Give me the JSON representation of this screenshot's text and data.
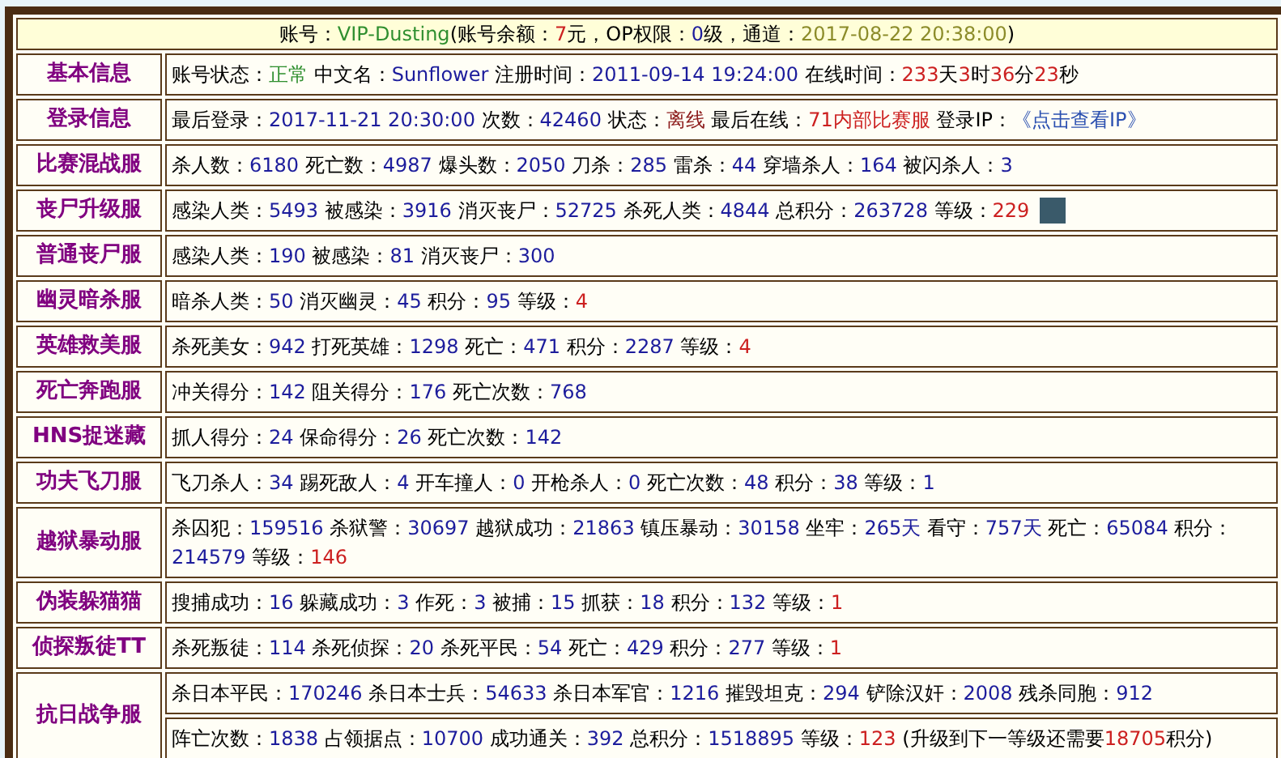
{
  "header": [
    [
      {
        "text": "账号：",
        "kind": "text"
      },
      {
        "text": "VIP-Dusting",
        "kind": "green"
      },
      {
        "text": "(账号余额：",
        "kind": "text"
      },
      {
        "text": "7",
        "kind": "red"
      },
      {
        "text": "元，OP权限：",
        "kind": "text"
      },
      {
        "text": "0",
        "kind": "num"
      },
      {
        "text": "级，通道：",
        "kind": "text"
      },
      {
        "text": "2017-08-22 20:38:00",
        "kind": "date"
      },
      {
        "text": ")",
        "kind": "text"
      }
    ]
  ],
  "rows": [
    {
      "label": "基本信息",
      "lines": [
        [
          [
            {
              "text": "账号状态：",
              "kind": "text"
            },
            {
              "text": "正常",
              "kind": "green"
            }
          ],
          [
            {
              "text": "中文名：",
              "kind": "text"
            },
            {
              "text": "Sunflower",
              "kind": "num"
            }
          ],
          [
            {
              "text": "注册时间：",
              "kind": "text"
            },
            {
              "text": "2011-09-14 19:24:00",
              "kind": "num"
            }
          ],
          [
            {
              "text": "在线时间：",
              "kind": "text"
            },
            {
              "text": "233",
              "kind": "red"
            },
            {
              "text": "天",
              "kind": "text"
            },
            {
              "text": "3",
              "kind": "red"
            },
            {
              "text": "时",
              "kind": "text"
            },
            {
              "text": "36",
              "kind": "red"
            },
            {
              "text": "分",
              "kind": "text"
            },
            {
              "text": "23",
              "kind": "red"
            },
            {
              "text": "秒",
              "kind": "text"
            }
          ]
        ]
      ]
    },
    {
      "label": "登录信息",
      "lines": [
        [
          [
            {
              "text": "最后登录：",
              "kind": "text"
            },
            {
              "text": "2017-11-21 20:30:00",
              "kind": "num"
            }
          ],
          [
            {
              "text": "次数：",
              "kind": "text"
            },
            {
              "text": "42460",
              "kind": "num"
            }
          ],
          [
            {
              "text": "状态：",
              "kind": "text"
            },
            {
              "text": "离线",
              "kind": "darkred"
            }
          ],
          [
            {
              "text": "最后在线：",
              "kind": "text"
            },
            {
              "text": "71内部比赛服",
              "kind": "red"
            }
          ],
          [
            {
              "text": "登录IP：",
              "kind": "text"
            },
            {
              "text": "《点击查看IP》",
              "kind": "link"
            }
          ]
        ]
      ]
    },
    {
      "label": "比赛混战服",
      "lines": [
        [
          [
            {
              "text": "杀人数：",
              "kind": "text"
            },
            {
              "text": "6180",
              "kind": "num"
            }
          ],
          [
            {
              "text": "死亡数：",
              "kind": "text"
            },
            {
              "text": "4987",
              "kind": "num"
            }
          ],
          [
            {
              "text": "爆头数：",
              "kind": "text"
            },
            {
              "text": "2050",
              "kind": "num"
            }
          ],
          [
            {
              "text": "刀杀：",
              "kind": "text"
            },
            {
              "text": "285",
              "kind": "num"
            }
          ],
          [
            {
              "text": "雷杀：",
              "kind": "text"
            },
            {
              "text": "44",
              "kind": "num"
            }
          ],
          [
            {
              "text": "穿墙杀人：",
              "kind": "text"
            },
            {
              "text": "164",
              "kind": "num"
            }
          ],
          [
            {
              "text": "被闪杀人：",
              "kind": "text"
            },
            {
              "text": "3",
              "kind": "num"
            }
          ]
        ]
      ]
    },
    {
      "label": "丧尸升级服",
      "lines": [
        [
          [
            {
              "text": "感染人类：",
              "kind": "text"
            },
            {
              "text": "5493",
              "kind": "num"
            }
          ],
          [
            {
              "text": "被感染：",
              "kind": "text"
            },
            {
              "text": "3916",
              "kind": "num"
            }
          ],
          [
            {
              "text": "消灭丧尸：",
              "kind": "text"
            },
            {
              "text": "52725",
              "kind": "num"
            }
          ],
          [
            {
              "text": "杀死人类：",
              "kind": "text"
            },
            {
              "text": "4844",
              "kind": "num"
            }
          ],
          [
            {
              "text": "总积分：",
              "kind": "text"
            },
            {
              "text": "263728",
              "kind": "num"
            }
          ],
          [
            {
              "text": "等级：",
              "kind": "text"
            },
            {
              "text": "229",
              "kind": "red"
            }
          ]
        ]
      ],
      "photo": true
    },
    {
      "label": "普通丧尸服",
      "lines": [
        [
          [
            {
              "text": "感染人类：",
              "kind": "text"
            },
            {
              "text": "190",
              "kind": "num"
            }
          ],
          [
            {
              "text": "被感染：",
              "kind": "text"
            },
            {
              "text": "81",
              "kind": "num"
            }
          ],
          [
            {
              "text": "消灭丧尸：",
              "kind": "text"
            },
            {
              "text": "300",
              "kind": "num"
            }
          ]
        ]
      ]
    },
    {
      "label": "幽灵暗杀服",
      "lines": [
        [
          [
            {
              "text": "暗杀人类：",
              "kind": "text"
            },
            {
              "text": "50",
              "kind": "num"
            }
          ],
          [
            {
              "text": "消灭幽灵：",
              "kind": "text"
            },
            {
              "text": "45",
              "kind": "num"
            }
          ],
          [
            {
              "text": "积分：",
              "kind": "text"
            },
            {
              "text": "95",
              "kind": "num"
            }
          ],
          [
            {
              "text": "等级：",
              "kind": "text"
            },
            {
              "text": "4",
              "kind": "red"
            }
          ]
        ]
      ]
    },
    {
      "label": "英雄救美服",
      "lines": [
        [
          [
            {
              "text": "杀死美女：",
              "kind": "text"
            },
            {
              "text": "942",
              "kind": "num"
            }
          ],
          [
            {
              "text": "打死英雄：",
              "kind": "text"
            },
            {
              "text": "1298",
              "kind": "num"
            }
          ],
          [
            {
              "text": "死亡：",
              "kind": "text"
            },
            {
              "text": "471",
              "kind": "num"
            }
          ],
          [
            {
              "text": "积分：",
              "kind": "text"
            },
            {
              "text": "2287",
              "kind": "num"
            }
          ],
          [
            {
              "text": "等级：",
              "kind": "text"
            },
            {
              "text": "4",
              "kind": "red"
            }
          ]
        ]
      ]
    },
    {
      "label": "死亡奔跑服",
      "lines": [
        [
          [
            {
              "text": "冲关得分：",
              "kind": "text"
            },
            {
              "text": "142",
              "kind": "num"
            }
          ],
          [
            {
              "text": "阻关得分：",
              "kind": "text"
            },
            {
              "text": "176",
              "kind": "num"
            }
          ],
          [
            {
              "text": "死亡次数：",
              "kind": "text"
            },
            {
              "text": "768",
              "kind": "num"
            }
          ]
        ]
      ]
    },
    {
      "label": "HNS捉迷藏",
      "lines": [
        [
          [
            {
              "text": "抓人得分：",
              "kind": "text"
            },
            {
              "text": "24",
              "kind": "num"
            }
          ],
          [
            {
              "text": "保命得分：",
              "kind": "text"
            },
            {
              "text": "26",
              "kind": "num"
            }
          ],
          [
            {
              "text": "死亡次数：",
              "kind": "text"
            },
            {
              "text": "142",
              "kind": "num"
            }
          ]
        ]
      ]
    },
    {
      "label": "功夫飞刀服",
      "lines": [
        [
          [
            {
              "text": "飞刀杀人：",
              "kind": "text"
            },
            {
              "text": "34",
              "kind": "num"
            }
          ],
          [
            {
              "text": "踢死敌人：",
              "kind": "text"
            },
            {
              "text": "4",
              "kind": "num"
            }
          ],
          [
            {
              "text": "开车撞人：",
              "kind": "text"
            },
            {
              "text": "0",
              "kind": "num"
            }
          ],
          [
            {
              "text": "开枪杀人：",
              "kind": "text"
            },
            {
              "text": "0",
              "kind": "num"
            }
          ],
          [
            {
              "text": "死亡次数：",
              "kind": "text"
            },
            {
              "text": "48",
              "kind": "num"
            }
          ],
          [
            {
              "text": "积分：",
              "kind": "text"
            },
            {
              "text": "38",
              "kind": "num"
            }
          ],
          [
            {
              "text": "等级：",
              "kind": "text"
            },
            {
              "text": "1",
              "kind": "num"
            }
          ]
        ]
      ]
    },
    {
      "label": "越狱暴动服",
      "lines": [
        [
          [
            {
              "text": "杀囚犯：",
              "kind": "text"
            },
            {
              "text": "159516",
              "kind": "num"
            }
          ],
          [
            {
              "text": "杀狱警：",
              "kind": "text"
            },
            {
              "text": "30697",
              "kind": "num"
            }
          ],
          [
            {
              "text": "越狱成功：",
              "kind": "text"
            },
            {
              "text": "21863",
              "kind": "num"
            }
          ],
          [
            {
              "text": "镇压暴动：",
              "kind": "text"
            },
            {
              "text": "30158",
              "kind": "num"
            }
          ],
          [
            {
              "text": "坐牢：",
              "kind": "text"
            },
            {
              "text": "265天",
              "kind": "num"
            }
          ],
          [
            {
              "text": "看守：",
              "kind": "text"
            },
            {
              "text": "757天",
              "kind": "num"
            }
          ],
          [
            {
              "text": "死亡：",
              "kind": "text"
            },
            {
              "text": "65084",
              "kind": "num"
            }
          ],
          [
            {
              "text": "积分：",
              "kind": "text"
            },
            {
              "text": "214579",
              "kind": "num"
            }
          ],
          [
            {
              "text": "等级：",
              "kind": "text"
            },
            {
              "text": "146",
              "kind": "red"
            }
          ]
        ]
      ]
    },
    {
      "label": "伪装躲猫猫",
      "lines": [
        [
          [
            {
              "text": "搜捕成功：",
              "kind": "text"
            },
            {
              "text": "16",
              "kind": "num"
            }
          ],
          [
            {
              "text": "躲藏成功：",
              "kind": "text"
            },
            {
              "text": "3",
              "kind": "num"
            }
          ],
          [
            {
              "text": "作死：",
              "kind": "text"
            },
            {
              "text": "3",
              "kind": "num"
            }
          ],
          [
            {
              "text": "被捕：",
              "kind": "text"
            },
            {
              "text": "15",
              "kind": "num"
            }
          ],
          [
            {
              "text": "抓获：",
              "kind": "text"
            },
            {
              "text": "18",
              "kind": "num"
            }
          ],
          [
            {
              "text": "积分：",
              "kind": "text"
            },
            {
              "text": "132",
              "kind": "num"
            }
          ],
          [
            {
              "text": "等级：",
              "kind": "text"
            },
            {
              "text": "1",
              "kind": "red"
            }
          ]
        ]
      ]
    },
    {
      "label": "侦探叛徒TT",
      "lines": [
        [
          [
            {
              "text": "杀死叛徒：",
              "kind": "text"
            },
            {
              "text": "114",
              "kind": "num"
            }
          ],
          [
            {
              "text": "杀死侦探：",
              "kind": "text"
            },
            {
              "text": "20",
              "kind": "num"
            }
          ],
          [
            {
              "text": "杀死平民：",
              "kind": "text"
            },
            {
              "text": "54",
              "kind": "num"
            }
          ],
          [
            {
              "text": "死亡：",
              "kind": "text"
            },
            {
              "text": "429",
              "kind": "num"
            }
          ],
          [
            {
              "text": "积分：",
              "kind": "text"
            },
            {
              "text": "277",
              "kind": "num"
            }
          ],
          [
            {
              "text": "等级：",
              "kind": "text"
            },
            {
              "text": "1",
              "kind": "red"
            }
          ]
        ]
      ]
    },
    {
      "label": "抗日战争服",
      "lines": [
        [
          [
            {
              "text": "杀日本平民：",
              "kind": "text"
            },
            {
              "text": "170246",
              "kind": "num"
            }
          ],
          [
            {
              "text": "杀日本士兵：",
              "kind": "text"
            },
            {
              "text": "54633",
              "kind": "num"
            }
          ],
          [
            {
              "text": "杀日本军官：",
              "kind": "text"
            },
            {
              "text": "1216",
              "kind": "num"
            }
          ],
          [
            {
              "text": "摧毁坦克：",
              "kind": "text"
            },
            {
              "text": "294",
              "kind": "num"
            }
          ],
          [
            {
              "text": "铲除汉奸：",
              "kind": "text"
            },
            {
              "text": "2008",
              "kind": "num"
            }
          ],
          [
            {
              "text": "残杀同胞：",
              "kind": "text"
            },
            {
              "text": "912",
              "kind": "num"
            }
          ]
        ],
        [
          [
            {
              "text": "阵亡次数：",
              "kind": "text"
            },
            {
              "text": "1838",
              "kind": "num"
            }
          ],
          [
            {
              "text": "占领据点：",
              "kind": "text"
            },
            {
              "text": "10700",
              "kind": "num"
            }
          ],
          [
            {
              "text": "成功通关：",
              "kind": "text"
            },
            {
              "text": "392",
              "kind": "num"
            }
          ],
          [
            {
              "text": "总积分：",
              "kind": "text"
            },
            {
              "text": "1518895",
              "kind": "num"
            }
          ],
          [
            {
              "text": "等级：",
              "kind": "text"
            },
            {
              "text": "123",
              "kind": "red"
            }
          ],
          [
            {
              "text": "(升级到下一等级还需要",
              "kind": "text"
            },
            {
              "text": "18705",
              "kind": "red"
            },
            {
              "text": "积分)",
              "kind": "text"
            }
          ]
        ]
      ]
    }
  ]
}
